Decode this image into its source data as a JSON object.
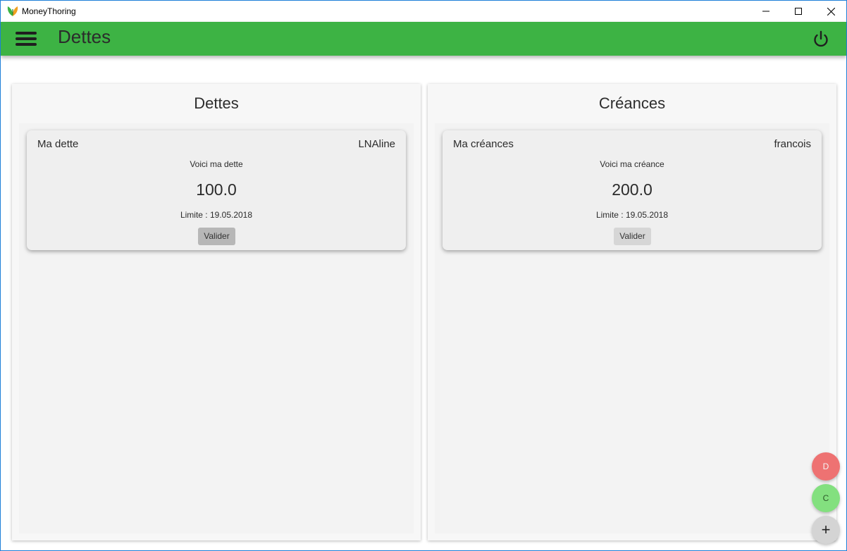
{
  "window": {
    "title": "MoneyThoring",
    "icon": "app-logo-icon"
  },
  "appbar": {
    "title": "Dettes",
    "menu_icon": "hamburger-menu-icon",
    "power_icon": "power-icon",
    "color": "#3db344"
  },
  "debts": {
    "header": "Dettes",
    "items": [
      {
        "title": "Ma dette",
        "person": "LNAline",
        "description": "Voici ma dette",
        "amount": "100.0",
        "limit": "Limite : 19.05.2018",
        "button_label": "Valider"
      }
    ]
  },
  "credits": {
    "header": "Créances",
    "items": [
      {
        "title": "Ma créances",
        "person": "francois",
        "description": "Voici ma créance",
        "amount": "200.0",
        "limit": "Limite : 19.05.2018",
        "button_label": "Valider"
      }
    ]
  },
  "fabs": {
    "debt_label": "D",
    "credit_label": "C",
    "add_label": "+",
    "debt_color": "#ee7272",
    "credit_color": "#83e07f"
  }
}
